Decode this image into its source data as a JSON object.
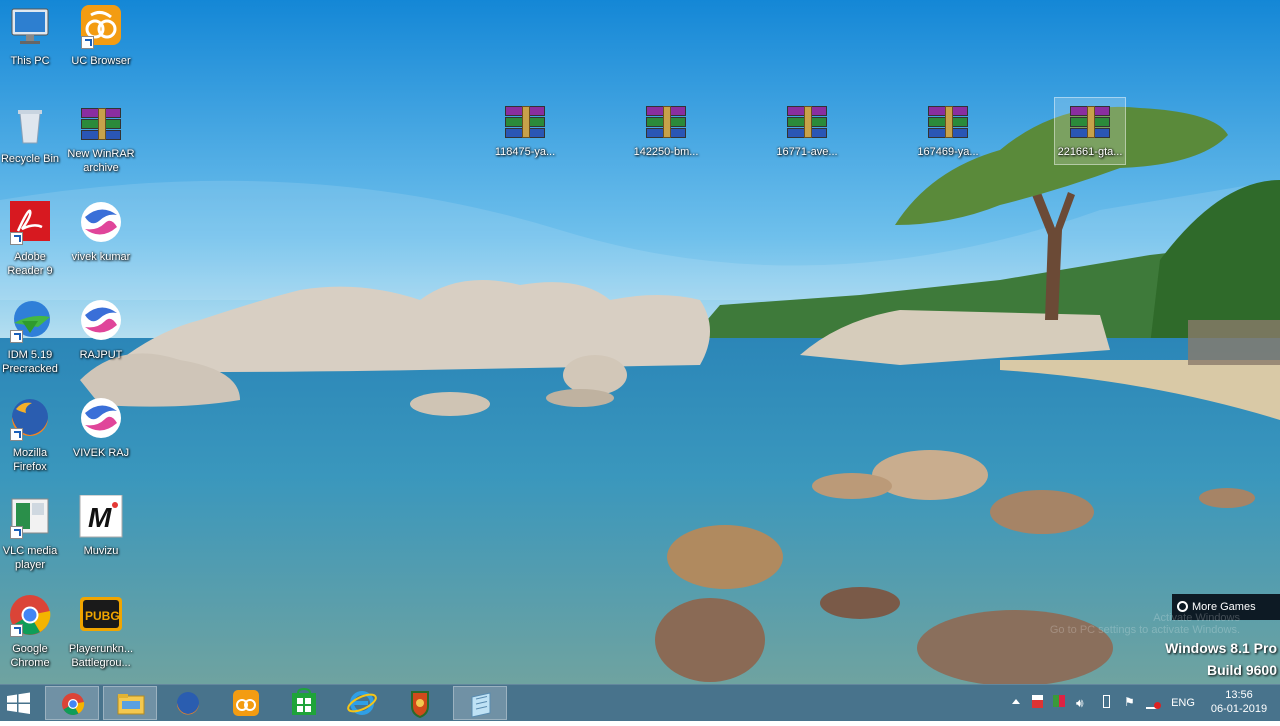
{
  "desktop_icons": [
    {
      "label": "This PC",
      "icon": "computer-icon"
    },
    {
      "label": "UC Browser",
      "icon": "uc-browser-icon"
    },
    {
      "label": "Recycle Bin",
      "icon": "recycle-bin-icon"
    },
    {
      "label": "New WinRAR archive",
      "icon": "winrar-icon"
    },
    {
      "label": "Adobe Reader 9",
      "icon": "adobe-reader-icon"
    },
    {
      "label": "vivek kumar",
      "icon": "browser-profile-icon"
    },
    {
      "label": "IDM 5.19 Precracked",
      "icon": "idm-icon"
    },
    {
      "label": "RAJPUT",
      "icon": "browser-profile-icon"
    },
    {
      "label": "Mozilla Firefox",
      "icon": "firefox-icon"
    },
    {
      "label": "VIVEK RAJ",
      "icon": "browser-profile-icon"
    },
    {
      "label": "VLC media player",
      "icon": "vlc-icon"
    },
    {
      "label": "Muvizu",
      "icon": "muvizu-icon"
    },
    {
      "label": "Google Chrome",
      "icon": "chrome-icon"
    },
    {
      "label": "Playerunkn... Battlegrou...",
      "icon": "pubg-icon"
    }
  ],
  "archive_files": [
    {
      "label": "118475-ya...",
      "icon": "winrar-icon"
    },
    {
      "label": "142250-bm...",
      "icon": "winrar-icon"
    },
    {
      "label": "16771-ave...",
      "icon": "winrar-icon"
    },
    {
      "label": "167469-ya...",
      "icon": "winrar-icon"
    },
    {
      "label": "221661-gta...",
      "icon": "winrar-icon"
    }
  ],
  "watermark": {
    "line1": "Windows 8.1 Pro",
    "line2": "Build 9600",
    "faint1": "Activate Windows",
    "faint2": "Go to PC settings to activate Windows."
  },
  "more_games": {
    "label": "More Games",
    "icon": "game-controller-icon"
  },
  "taskbar": {
    "start_icon": "windows-start-icon",
    "pinned": [
      {
        "name": "chrome",
        "icon": "chrome-icon",
        "active": true
      },
      {
        "name": "file-explorer",
        "icon": "folder-icon",
        "active": true
      },
      {
        "name": "firefox",
        "icon": "firefox-icon",
        "active": false
      },
      {
        "name": "uc-browser",
        "icon": "uc-browser-icon",
        "active": false
      },
      {
        "name": "store",
        "icon": "store-icon",
        "active": false
      },
      {
        "name": "internet-explorer",
        "icon": "internet-explorer-icon",
        "active": false
      },
      {
        "name": "app",
        "icon": "app-shield-icon",
        "active": false
      },
      {
        "name": "notepad",
        "icon": "notepad-icon",
        "active": true
      }
    ],
    "tray": {
      "language": "ENG",
      "time": "13:56",
      "date": "06-01-2019",
      "icons": [
        "chevron-up-icon",
        "flag-icon",
        "network-icon",
        "speaker-icon",
        "battery-icon",
        "action-center-flag-icon",
        "network-disconnected-icon"
      ]
    }
  },
  "colors": {
    "taskbar": "#2d5f7a",
    "label_text": "#ffffff"
  }
}
